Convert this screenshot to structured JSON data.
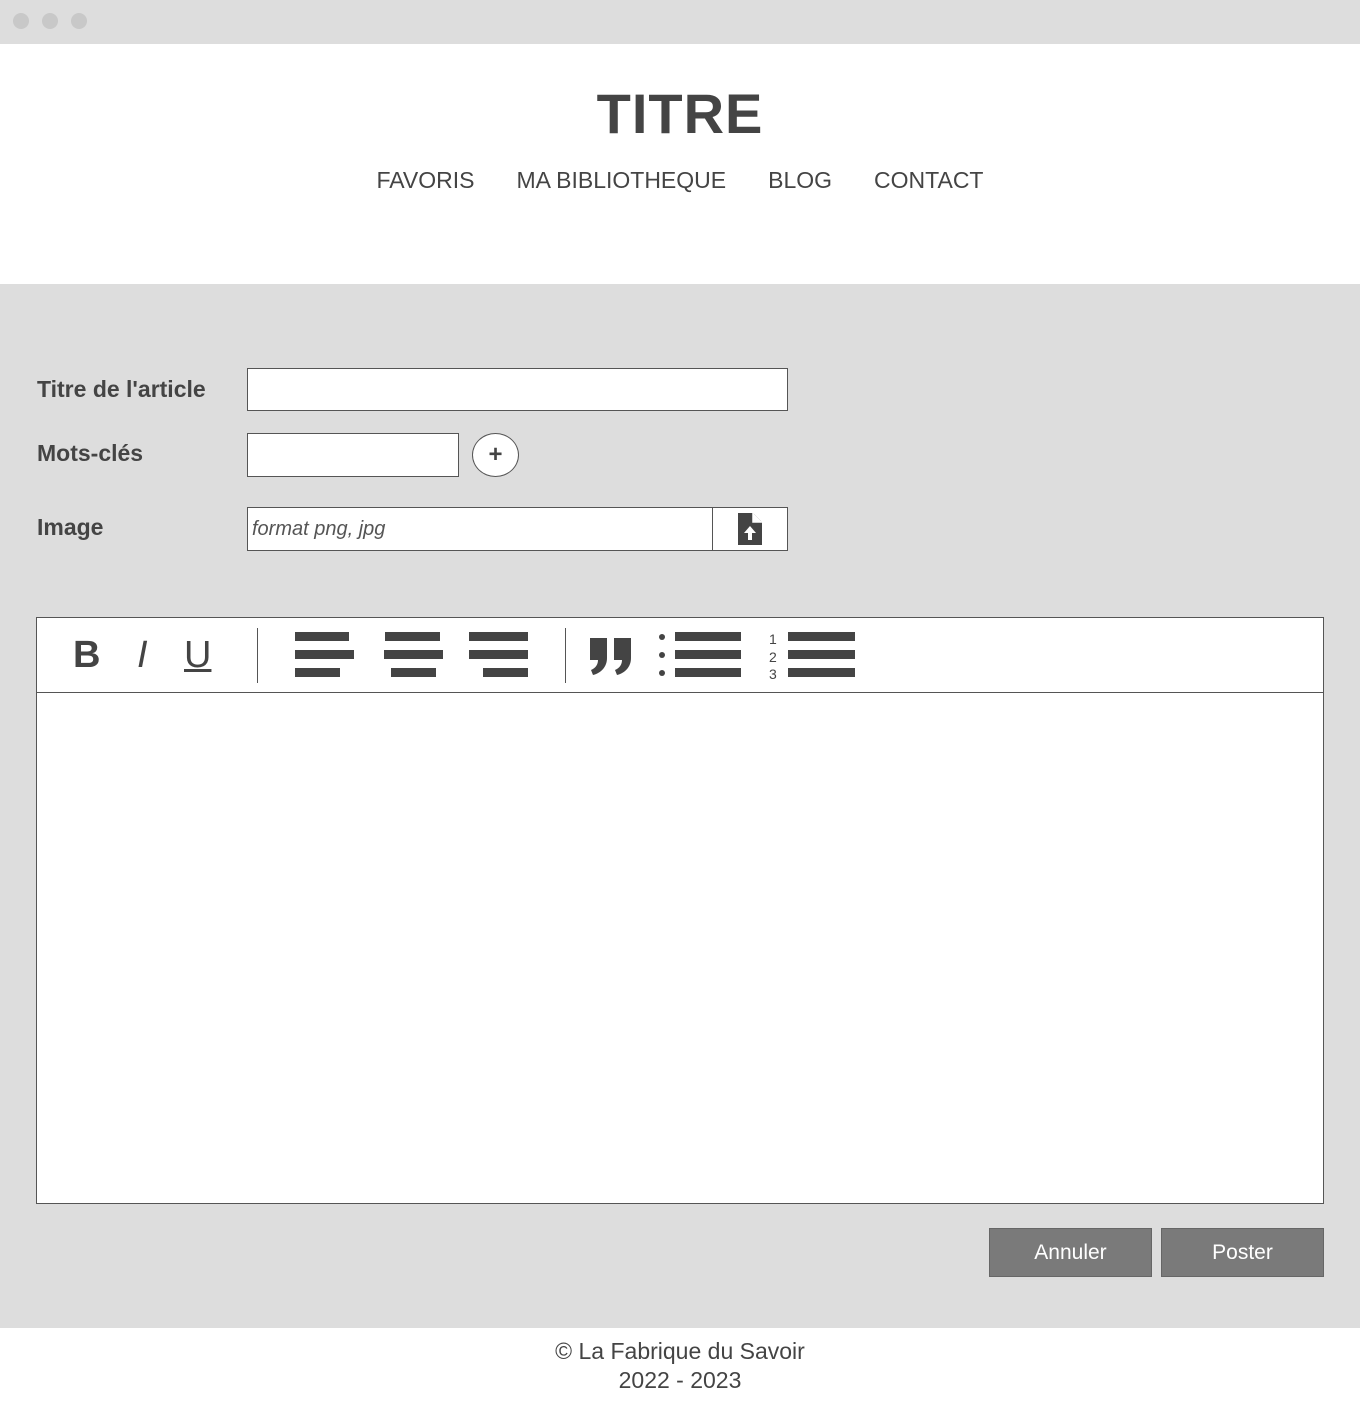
{
  "site": {
    "title": "TITRE"
  },
  "nav": {
    "items": [
      "FAVORIS",
      "MA BIBLIOTHEQUE",
      "BLOG",
      "CONTACT"
    ]
  },
  "form": {
    "article_title": {
      "label": "Titre de l'article",
      "value": ""
    },
    "keywords": {
      "label": "Mots-clés",
      "value": "",
      "add_label": "+"
    },
    "image": {
      "label": "Image",
      "placeholder": "format png, jpg"
    }
  },
  "editor": {
    "toolbar": {
      "bold": "B",
      "italic": "I",
      "underline": "U",
      "ordered_numbers": [
        "1",
        "2",
        "3"
      ]
    },
    "content": ""
  },
  "actions": {
    "cancel": "Annuler",
    "submit": "Poster"
  },
  "footer": {
    "copyright": "© La Fabrique du Savoir",
    "years": "2022 - 2023"
  },
  "icons": {
    "upload": "file-upload-icon",
    "align_left": "align-left-icon",
    "align_center": "align-center-icon",
    "align_right": "align-right-icon",
    "quote": "quote-icon",
    "bullet_list": "bullet-list-icon",
    "numbered_list": "numbered-list-icon"
  }
}
